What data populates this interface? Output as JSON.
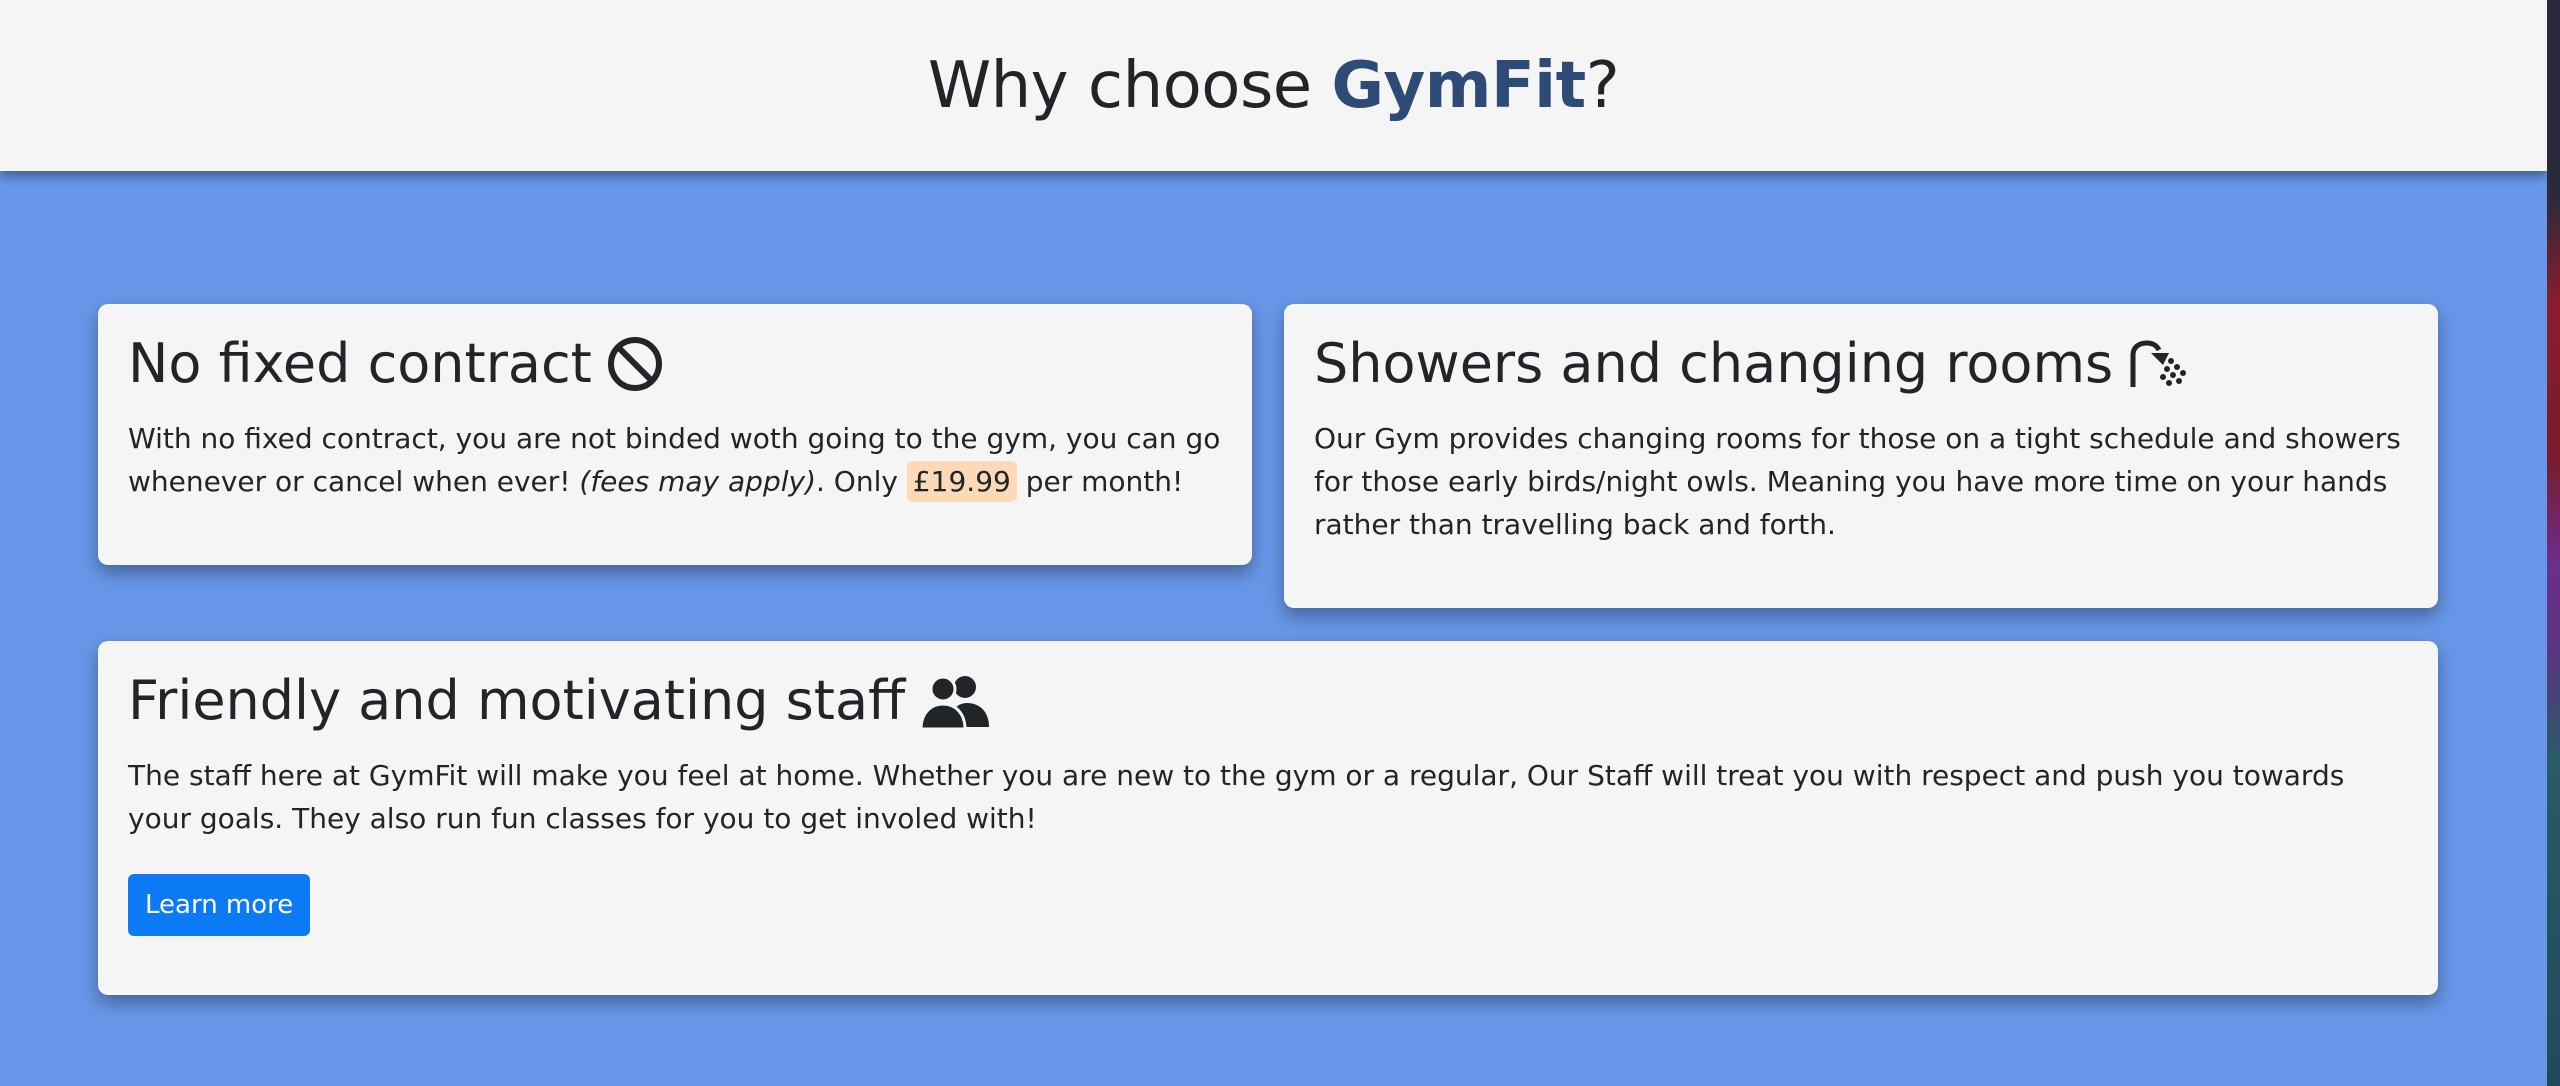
{
  "header": {
    "title_prefix": "Why choose ",
    "brand": "GymFit",
    "title_suffix": "?"
  },
  "cards": [
    {
      "title": "No fixed contract",
      "icon": "ban-icon",
      "text_before": "With no fixed contract, you are not binded woth going to the gym, you can go whenever or cancel when ever! ",
      "text_italic": "(fees may apply)",
      "text_mid": ". Only ",
      "price": "£19.99",
      "text_after": " per month!"
    },
    {
      "title": "Showers and changing rooms",
      "icon": "shower-icon",
      "text": "Our Gym provides changing rooms for those on a tight schedule and showers for those early birds/night owls. Meaning you have more time on your hands rather than travelling back and forth."
    },
    {
      "title": "Friendly and motivating staff",
      "icon": "users-icon",
      "text": "The staff here at GymFit will make you feel at home. Whether you are new to the gym or a regular, Our Staff will treat you with respect and push you towards your goals. They also run fun classes for you to get involed with!",
      "button_label": "Learn more"
    }
  ],
  "colors": {
    "background": "#6897e9",
    "card": "#f5f5f5",
    "brand": "#2e4a76",
    "button": "#0d7af5",
    "price_highlight": "#fcd9b7"
  }
}
